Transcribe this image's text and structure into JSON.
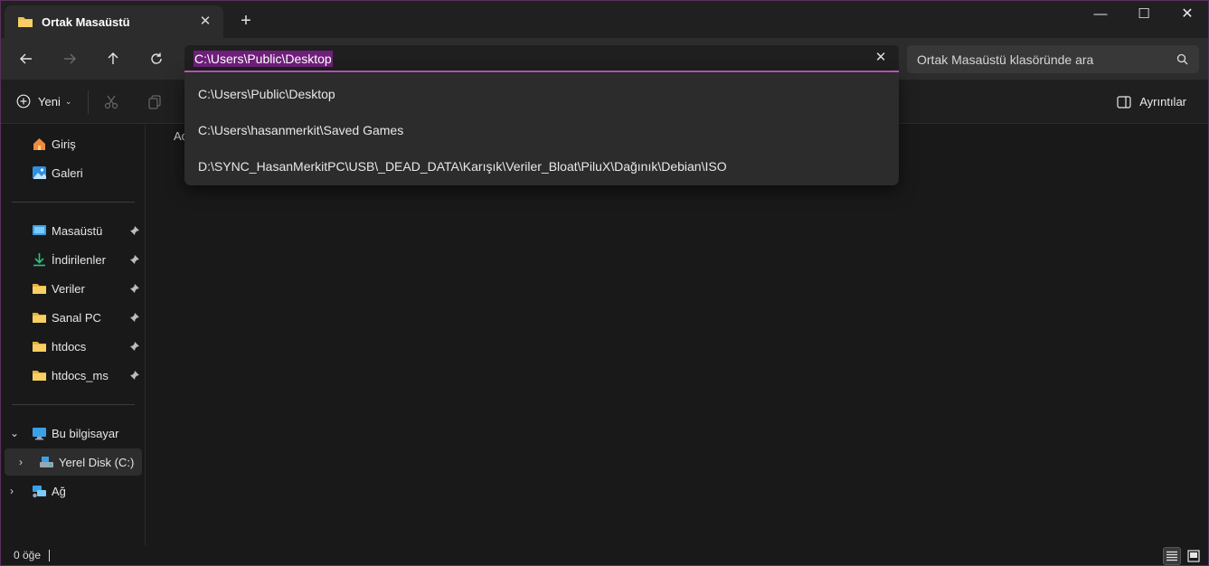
{
  "window": {
    "tab_title": "Ortak Masaüstü",
    "tab_close": "✕",
    "new_tab": "+",
    "minimize": "—",
    "maximize": "☐",
    "close": "✕"
  },
  "nav": {
    "back_icon": "arrow-left-icon",
    "forward_icon": "arrow-right-icon",
    "up_icon": "arrow-up-icon",
    "refresh_icon": "refresh-icon"
  },
  "address_bar": {
    "value": "C:\\Users\\Public\\Desktop",
    "clear": "✕",
    "accent_color": "#c15cc8",
    "selection_color": "#6e1f7a"
  },
  "address_suggestions": [
    "C:\\Users\\Public\\Desktop",
    "C:\\Users\\hasanmerkit\\Saved Games",
    "D:\\SYNC_HasanMerkitPC\\USB\\_DEAD_DATA\\Karışık\\Veriler_Bloat\\PiluX\\Dağınık\\Debian\\ISO"
  ],
  "search": {
    "placeholder": "Ortak Masaüstü klasöründe ara"
  },
  "toolbar": {
    "new_label": "Yeni",
    "new_chevron": "⌄",
    "details_label": "Ayrıntılar"
  },
  "sidebar": {
    "quick": [
      {
        "label": "Giriş",
        "icon": "home-icon"
      },
      {
        "label": "Galeri",
        "icon": "gallery-icon"
      }
    ],
    "pinned": [
      {
        "label": "Masaüstü",
        "icon": "desktop-icon"
      },
      {
        "label": "İndirilenler",
        "icon": "download-icon"
      },
      {
        "label": "Veriler",
        "icon": "folder-icon"
      },
      {
        "label": "Sanal PC",
        "icon": "folder-icon"
      },
      {
        "label": "htdocs",
        "icon": "folder-icon"
      },
      {
        "label": "htdocs_ms",
        "icon": "folder-icon"
      }
    ],
    "tree": [
      {
        "label": "Bu bilgisayar",
        "icon": "computer-icon",
        "expander": "⌄"
      },
      {
        "label": "Yerel Disk (C:)",
        "icon": "drive-icon",
        "expander": "›"
      },
      {
        "label": "Ağ",
        "icon": "network-icon",
        "expander": "›"
      }
    ]
  },
  "content": {
    "column_header": "Ad"
  },
  "status": {
    "item_count": "0 öğe"
  }
}
